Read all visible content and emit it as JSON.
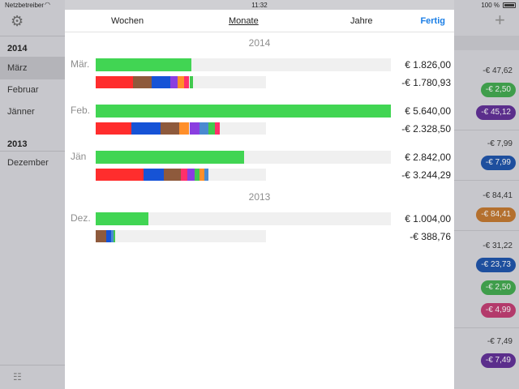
{
  "status_bar": {
    "carrier": "Netzbetreiber",
    "time": "11:32",
    "battery": "100 %"
  },
  "master": {
    "sections": [
      {
        "year": "2014",
        "months": [
          "März",
          "Februar",
          "Jänner"
        ]
      },
      {
        "year": "2013",
        "months": [
          "Dezember"
        ]
      }
    ]
  },
  "detail": {
    "totals": [
      "-€ 47,62",
      "-€ 7,99",
      "-€ 84,41",
      "-€ 31,22",
      "-€ 7,49"
    ],
    "pills": [
      {
        "label": "-€ 2,50",
        "color": "#3f9d4b"
      },
      {
        "label": "-€ 45,12",
        "color": "#5b2e8c"
      },
      {
        "label": "-€ 7,99",
        "color": "#1e4f9e"
      },
      {
        "label": "-€ 84,41",
        "color": "#b4702e"
      },
      {
        "label": "-€ 23,73",
        "color": "#1e4f9e"
      },
      {
        "label": "-€ 2,50",
        "color": "#3f9d4b"
      },
      {
        "label": "-€ 4,99",
        "color": "#b33a6b"
      },
      {
        "label": "-€ 7,49",
        "color": "#5b2e8c"
      }
    ]
  },
  "sheet": {
    "segments": [
      "Wochen",
      "Monate",
      "Jahre"
    ],
    "active_segment": "Monate",
    "done_label": "Fertig",
    "years": [
      "2014",
      "2013"
    ],
    "months": [
      {
        "label": "Mär.",
        "income": "€ 1.826,00",
        "income_fraction": 0.324,
        "expense": "-€ 1.780,93",
        "expense_fraction": 0.565,
        "categories": [
          {
            "color": "#ff2d2d",
            "value": 0.22
          },
          {
            "color": "#8e5a3c",
            "value": 0.11
          },
          {
            "color": "#1653d6",
            "value": 0.11
          },
          {
            "color": "#8a3ee0",
            "value": 0.04
          },
          {
            "color": "#ff8f2a",
            "value": 0.04
          },
          {
            "color": "#ff2f6b",
            "value": 0.03
          },
          {
            "color": "#41c94e",
            "value": 0.02
          }
        ]
      },
      {
        "label": "Feb.",
        "income": "€ 5.640,00",
        "income_fraction": 1.0,
        "expense": "-€ 2.328,50",
        "expense_fraction": 0.733,
        "categories": [
          {
            "color": "#ff2d2d",
            "value": 0.21
          },
          {
            "color": "#1653d6",
            "value": 0.17
          },
          {
            "color": "#8e5a3c",
            "value": 0.11
          },
          {
            "color": "#ff8f2a",
            "value": 0.06
          },
          {
            "color": "#8a3ee0",
            "value": 0.06
          },
          {
            "color": "#4a8ad1",
            "value": 0.05
          },
          {
            "color": "#41c94e",
            "value": 0.04
          },
          {
            "color": "#ff2f6b",
            "value": 0.03
          }
        ]
      },
      {
        "label": "Jän",
        "income": "€ 2.842,00",
        "income_fraction": 0.504,
        "expense": "-€ 3.244,29",
        "expense_fraction": 1.0,
        "categories": [
          {
            "color": "#ff2d2d",
            "value": 0.28
          },
          {
            "color": "#1653d6",
            "value": 0.12
          },
          {
            "color": "#8e5a3c",
            "value": 0.1
          },
          {
            "color": "#ff2f6b",
            "value": 0.04
          },
          {
            "color": "#8a3ee0",
            "value": 0.04
          },
          {
            "color": "#41c94e",
            "value": 0.03
          },
          {
            "color": "#ff8f2a",
            "value": 0.03
          },
          {
            "color": "#4a8ad1",
            "value": 0.02
          }
        ]
      },
      {
        "label": "Dez.",
        "income": "€ 1.004,00",
        "income_fraction": 0.178,
        "expense": "-€ 388,76",
        "expense_fraction": 0.12,
        "categories": [
          {
            "color": "#8e5a3c",
            "value": 0.06
          },
          {
            "color": "#1653d6",
            "value": 0.03
          },
          {
            "color": "#4a8ad1",
            "value": 0.015
          },
          {
            "color": "#41c94e",
            "value": 0.01
          }
        ]
      }
    ]
  }
}
